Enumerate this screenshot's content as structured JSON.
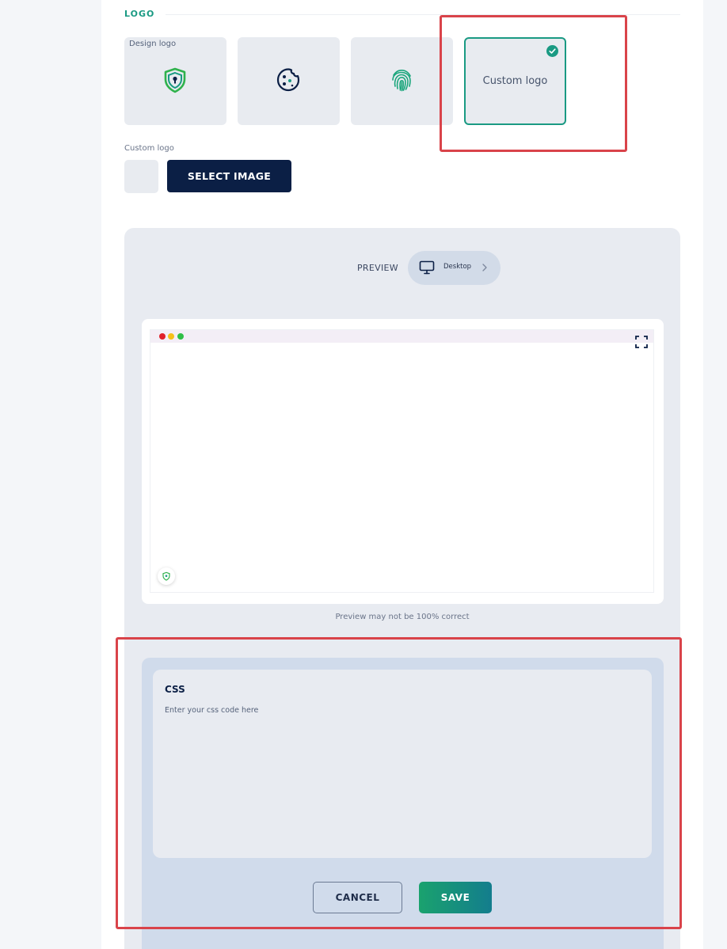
{
  "logo_section": {
    "title": "LOGO",
    "options": [
      {
        "caption": "Design logo",
        "icon": "shield-lock-icon"
      },
      {
        "caption": "",
        "icon": "cookie-icon"
      },
      {
        "caption": "",
        "icon": "fingerprint-icon"
      },
      {
        "caption": "",
        "label": "Custom logo",
        "icon": "check-icon",
        "selected": true
      }
    ],
    "custom_logo_label": "Custom logo",
    "select_image_label": "SELECT IMAGE"
  },
  "preview": {
    "label": "PREVIEW",
    "device": "Desktop",
    "note": "Preview may not be 100% correct"
  },
  "css": {
    "title": "CSS",
    "placeholder": "Enter your css code here",
    "value": ""
  },
  "actions": {
    "cancel_label": "CANCEL",
    "save_label": "SAVE"
  },
  "colors": {
    "accent": "#1a9a83",
    "primary_dark": "#0b1f45",
    "highlight": "#d9434a"
  }
}
